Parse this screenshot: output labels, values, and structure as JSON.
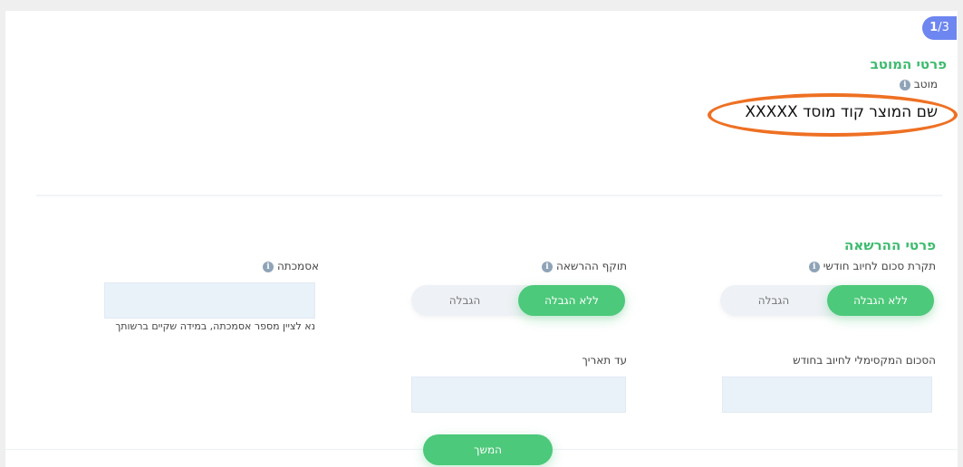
{
  "step": {
    "current": "1",
    "total": "/3"
  },
  "beneficiary": {
    "title": "פרטי המוטב",
    "field_label": "מוטב",
    "value": "שם המוצר קוד מוסד XXXXX"
  },
  "authorization": {
    "title": "פרטי ההרשאה",
    "monthly_cap": {
      "label": "תקרת סכום לחיוב חודשי",
      "options": [
        "ללא הגבלה",
        "הגבלה"
      ],
      "selected": "ללא הגבלה",
      "max_amount_label": "הסכום המקסימלי לחיוב בחודש",
      "max_amount_value": ""
    },
    "validity": {
      "label": "תוקף ההרשאה",
      "options": [
        "ללא הגבלה",
        "הגבלה"
      ],
      "selected": "ללא הגבלה",
      "until_date_label": "עד תאריך",
      "until_date_value": ""
    },
    "reference": {
      "label": "אסמכתה",
      "value": "",
      "hint": "נא לציין מספר אסמכתה, במידה שקיים ברשותך"
    }
  },
  "actions": {
    "continue_label": "המשך"
  },
  "colors": {
    "accent_green": "#4cc97a",
    "title_green": "#3dbb6e",
    "step_blue": "#6d86f0",
    "highlight_orange": "#ee7023"
  },
  "icons": {
    "info": "info-icon"
  }
}
